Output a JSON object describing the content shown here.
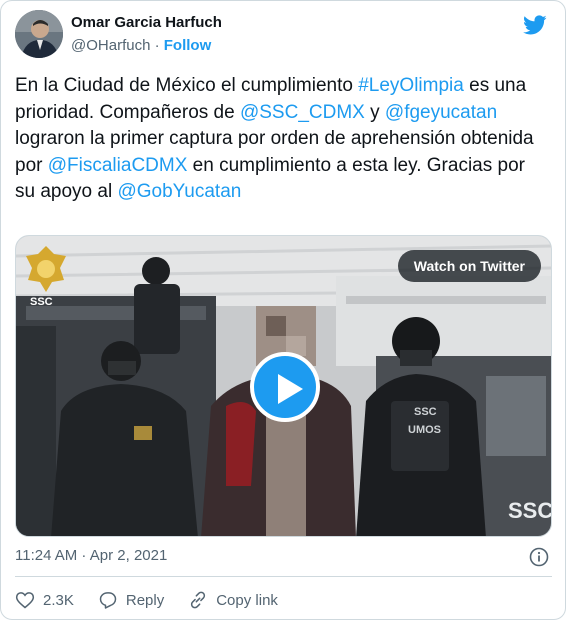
{
  "author": {
    "name": "Omar Garcia Harfuch",
    "handle": "@OHarfuch",
    "separator": "·",
    "follow_label": "Follow"
  },
  "tweet": {
    "t1": "En la Ciudad de México el cumplimiento ",
    "hashtag": "#LeyOlimpia",
    "t2": " es una prioridad. Compañeros de ",
    "mention1": "@SSC_CDMX",
    "t3": " y ",
    "mention2": "@fgeyucatan",
    "t4": " lograron la primer captura por orden de aprehensión obtenida por ",
    "mention3": "@FiscaliaCDMX",
    "t5": " en cumplimiento a esta ley. Gracias por su apoyo al ",
    "mention4": "@GobYucatan"
  },
  "media": {
    "watch_label": "Watch on Twitter",
    "logo_text": "SSC",
    "vest_text_1": "SSC",
    "vest_text_2": "UMOS",
    "truck_text": "SSC"
  },
  "meta": {
    "timestamp": "11:24 AM · Apr 2, 2021"
  },
  "actions": {
    "like_count": "2.3K",
    "reply_label": "Reply",
    "copy_label": "Copy link"
  },
  "colors": {
    "accent": "#1d9bf0",
    "text": "#0f1419",
    "muted": "#536471",
    "border": "#cfd9de"
  }
}
